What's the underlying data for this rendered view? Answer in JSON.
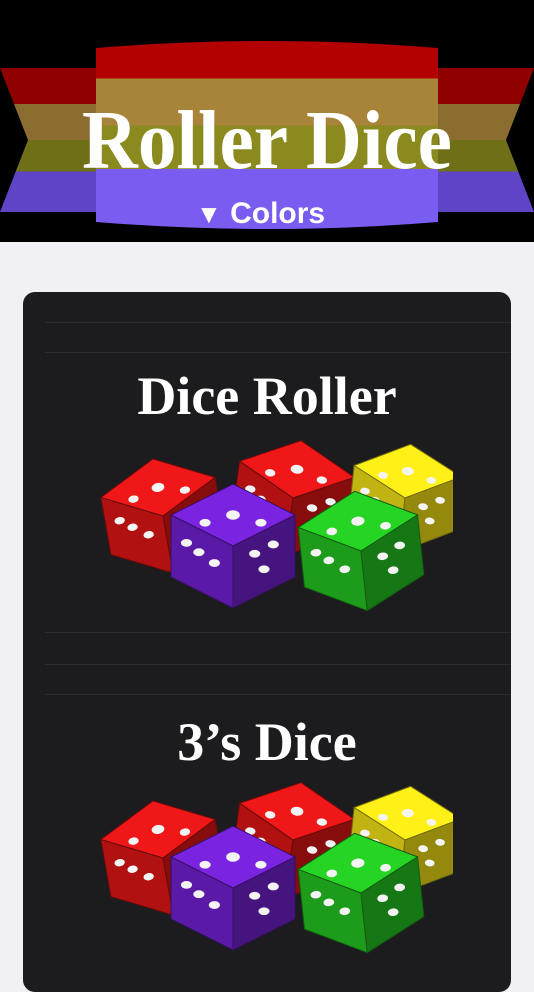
{
  "header": {
    "title": "Roller Dice",
    "colors_label": "Colors",
    "colors_arrow": "▼",
    "banner_colors": [
      "#b30000",
      "#a8833a",
      "#8a8a1f",
      "#7b5cf0"
    ]
  },
  "list": {
    "items": [
      {
        "title": "Dice Roller"
      },
      {
        "title": "3’s Dice"
      }
    ]
  },
  "dice_colors": {
    "red": "#d01414",
    "purple": "#6a1fc4",
    "yellow": "#e3d214",
    "green": "#21b81f"
  }
}
